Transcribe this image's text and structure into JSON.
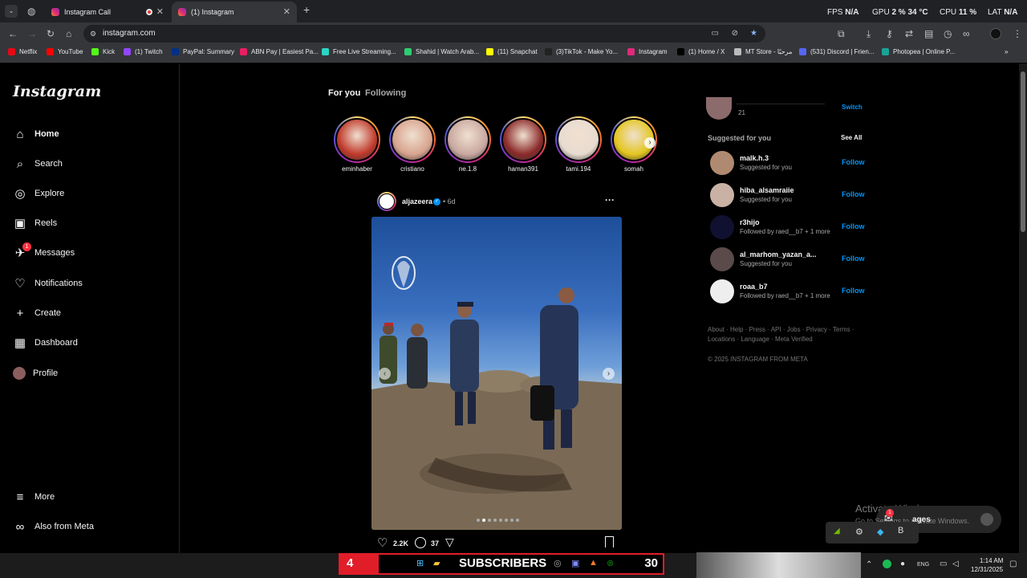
{
  "browser": {
    "tabs": [
      {
        "title": "Instagram Call"
      },
      {
        "title": "(1) Instagram"
      }
    ],
    "url": "instagram.com",
    "stats": {
      "fps_label": "FPS",
      "fps_val": "N/A",
      "gpu_label": "GPU",
      "gpu_val": "2 %",
      "gpu_temp": "34 °C",
      "cpu_label": "CPU",
      "cpu_val": "11 %",
      "lat_label": "LAT",
      "lat_val": "N/A"
    },
    "bookmarks": [
      {
        "label": "Netflix",
        "color": "#e50914"
      },
      {
        "label": "YouTube",
        "color": "#ff0000"
      },
      {
        "label": "Kick",
        "color": "#53fc18"
      },
      {
        "label": "(1) Twitch",
        "color": "#9146ff"
      },
      {
        "label": "PayPal: Summary",
        "color": "#003087"
      },
      {
        "label": "ABN Pay | Easiest Pa...",
        "color": "#e91e63"
      },
      {
        "label": "Free Live Streaming...",
        "color": "#2bd5c4"
      },
      {
        "label": "Shahid | Watch Arab...",
        "color": "#2ecc71"
      },
      {
        "label": "(11) Snapchat",
        "color": "#fffc00"
      },
      {
        "label": "(3)TikTok - Make Yo...",
        "color": "#222222"
      },
      {
        "label": "Instagram",
        "color": "#dd2a7b"
      },
      {
        "label": "(1) Home / X",
        "color": "#000000"
      },
      {
        "label": "MT Store - مرحبًا",
        "color": "#bbbbbb"
      },
      {
        "label": "(531) Discord | Frien...",
        "color": "#5865f2"
      },
      {
        "label": "Photopea | Online P...",
        "color": "#18a497"
      }
    ]
  },
  "sidebar": {
    "logo": "Instagram",
    "items": [
      {
        "label": "Home",
        "icon": "home-icon"
      },
      {
        "label": "Search",
        "icon": "search-icon"
      },
      {
        "label": "Explore",
        "icon": "compass-icon"
      },
      {
        "label": "Reels",
        "icon": "reels-icon"
      },
      {
        "label": "Messages",
        "icon": "messenger-icon",
        "badge": "1"
      },
      {
        "label": "Notifications",
        "icon": "heart-icon"
      },
      {
        "label": "Create",
        "icon": "plus-icon"
      },
      {
        "label": "Dashboard",
        "icon": "dashboard-icon"
      },
      {
        "label": "Profile",
        "icon": "avatar"
      }
    ],
    "bottom": [
      {
        "label": "More",
        "icon": "menu-icon"
      },
      {
        "label": "Also from Meta",
        "icon": "meta-icon"
      }
    ]
  },
  "feed": {
    "tabs": {
      "for_you": "For you",
      "following": "Following"
    },
    "stories": [
      {
        "name": "eminhaber",
        "color": "#c0392b"
      },
      {
        "name": "cristiano",
        "color": "#d8a48f"
      },
      {
        "name": "ne.1.8",
        "color": "#c9a8a0"
      },
      {
        "name": "haman391",
        "color": "#8b2a2a"
      },
      {
        "name": "tami.194",
        "color": "#e8dcd0"
      },
      {
        "name": "somah",
        "color": "#e4c61f"
      }
    ],
    "post": {
      "username": "aljazeera",
      "time": "6d",
      "likes": "2.2K",
      "comments": "37"
    }
  },
  "right": {
    "current_user_count": "21",
    "switch_label": "Switch",
    "suggested_title": "Suggested for you",
    "see_all": "See All",
    "suggestions": [
      {
        "user": "malk.h.3",
        "sub": "Suggested for you",
        "color": "#b08a70"
      },
      {
        "user": "hiba_alsamraiie",
        "sub": "Suggested for you",
        "color": "#c9b2a4"
      },
      {
        "user": "r3hijo",
        "sub": "Followed by raed__b7 + 1 more",
        "color": "#101030"
      },
      {
        "user": "al_marhom_yazan_a...",
        "sub": "Suggested for you",
        "color": "#5a4a4a"
      },
      {
        "user": "roaa_b7",
        "sub": "Followed by raed__b7 + 1 more",
        "color": "#eeeeee"
      }
    ],
    "follow_label": "Follow",
    "footer_line1": "About · Help · Press · API · Jobs · Privacy · Terms ·",
    "footer_line2": "Locations · Language · Meta Verified",
    "copyright": "© 2025 INSTAGRAM FROM META"
  },
  "overlay": {
    "activate_title": "Activate Windows",
    "activate_sub": "Go to Settings to activate Windows.",
    "messages_label": "ages",
    "messages_badge": "1"
  },
  "taskbar": {
    "subs_count": "4",
    "subs_label": "SUBSCRIBERS",
    "subs_goal": "30",
    "lang": "ENG",
    "time": "1:14 AM",
    "date": "12/31/2025"
  }
}
